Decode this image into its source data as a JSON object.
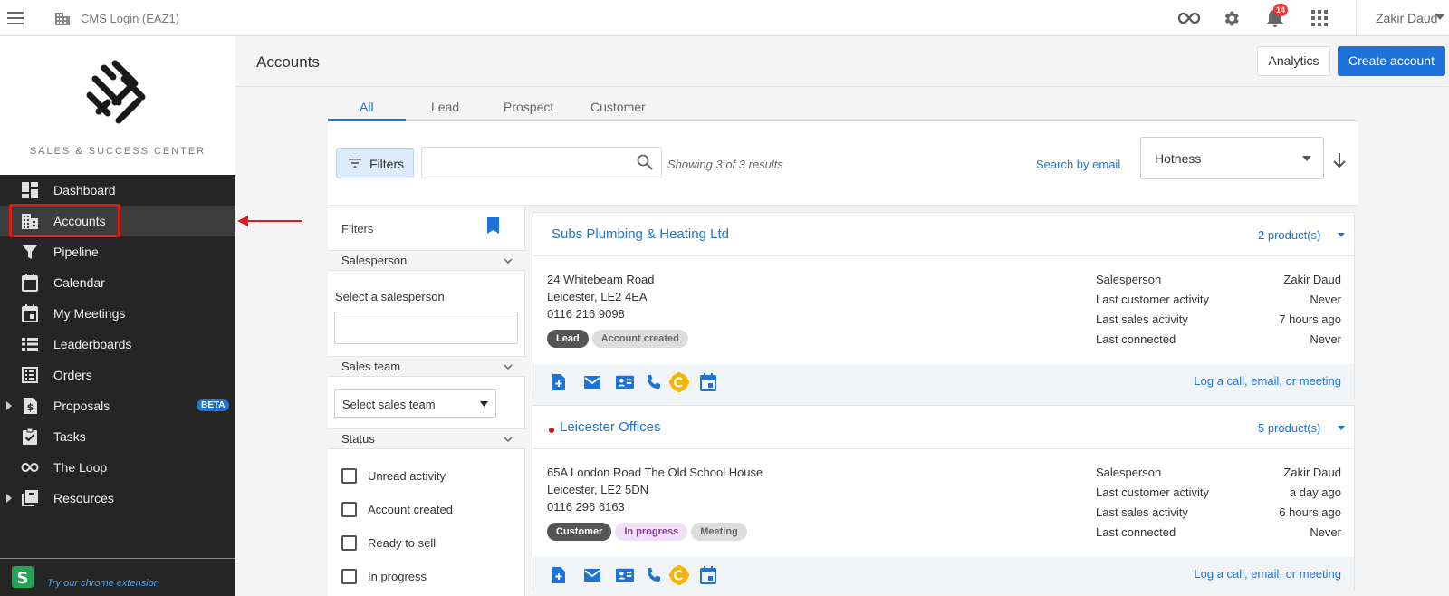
{
  "topbar": {
    "app_title": "CMS Login (EAZ1)",
    "notification_count": "14",
    "user_name": "Zakir Daud"
  },
  "sidebar": {
    "logo_text": "SALES & SUCCESS CENTER",
    "items": [
      {
        "label": "Dashboard",
        "icon": "dashboard-icon"
      },
      {
        "label": "Accounts",
        "icon": "building-icon"
      },
      {
        "label": "Pipeline",
        "icon": "funnel-icon"
      },
      {
        "label": "Calendar",
        "icon": "calendar-icon"
      },
      {
        "label": "My Meetings",
        "icon": "meetings-icon"
      },
      {
        "label": "Leaderboards",
        "icon": "list-icon"
      },
      {
        "label": "Orders",
        "icon": "orders-icon"
      },
      {
        "label": "Proposals",
        "icon": "dollar-file-icon",
        "badge": "BETA"
      },
      {
        "label": "Tasks",
        "icon": "clipboard-check-icon"
      },
      {
        "label": "The Loop",
        "icon": "infinity-icon"
      },
      {
        "label": "Resources",
        "icon": "library-icon"
      }
    ],
    "extension_text": "Try our chrome extension"
  },
  "page": {
    "title": "Accounts",
    "analytics_label": "Analytics",
    "create_label": "Create account",
    "tabs": [
      "All",
      "Lead",
      "Prospect",
      "Customer"
    ],
    "active_tab": "All"
  },
  "toolbar": {
    "filters_label": "Filters",
    "search_value": "",
    "results_text": "Showing 3 of 3 results",
    "search_by_email": "Search by email",
    "sort_value": "Hotness"
  },
  "filters": {
    "title": "Filters",
    "salesperson_heading": "Salesperson",
    "salesperson_label": "Select a salesperson",
    "salesperson_value": "",
    "sales_team_heading": "Sales team",
    "sales_team_value": "Select sales team",
    "status_heading": "Status",
    "status_options": [
      "Unread activity",
      "Account created",
      "Ready to sell",
      "In progress"
    ]
  },
  "accounts": [
    {
      "name": "Subs Plumbing & Heating Ltd",
      "products": "2 product(s)",
      "address1": "24 Whitebeam Road",
      "address2": "Leicester, LE2 4EA",
      "phone": "0116 216 9098",
      "tags": [
        "Lead",
        "Account created"
      ],
      "salesperson_label": "Salesperson",
      "salesperson": "Zakir Daud",
      "last_customer_label": "Last customer activity",
      "last_customer": "Never",
      "last_sales_label": "Last sales activity",
      "last_sales": "7 hours ago",
      "last_connected_label": "Last connected",
      "last_connected": "Never",
      "log_label": "Log a call, email, or meeting"
    },
    {
      "name": "Leicester Offices",
      "products": "5 product(s)",
      "address1": "65A London Road The Old School House",
      "address2": "Leicester, LE2 5DN",
      "phone": "0116 296 6163",
      "tags": [
        "Customer",
        "In progress",
        "Meeting"
      ],
      "salesperson_label": "Salesperson",
      "salesperson": "Zakir Daud",
      "last_customer_label": "Last customer activity",
      "last_customer": "a day ago",
      "last_sales_label": "Last sales activity",
      "last_sales": "6 hours ago",
      "last_connected_label": "Last connected",
      "last_connected": "Never",
      "log_label": "Log a call, email, or meeting"
    }
  ],
  "colors": {
    "accent": "#1e73d8",
    "sidebar_bg": "#252525",
    "highlight": "#e01919",
    "notification": "#e53935"
  }
}
